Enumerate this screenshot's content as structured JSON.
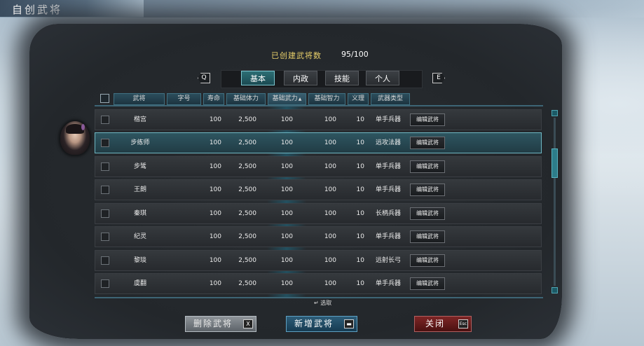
{
  "window": {
    "title": "自创武将"
  },
  "summary": {
    "label": "已创建武将数",
    "value": "95/100"
  },
  "tabs": {
    "prev_key": "Q",
    "next_key": "E",
    "items": [
      {
        "label": "基本",
        "active": true
      },
      {
        "label": "内政",
        "active": false
      },
      {
        "label": "技能",
        "active": false
      },
      {
        "label": "个人",
        "active": false
      }
    ]
  },
  "columns": [
    "武将",
    "字号",
    "寿命",
    "基础体力",
    "基础武力",
    "基础智力",
    "义理",
    "武器类型"
  ],
  "sort_indicator": "▲",
  "rows": [
    {
      "name": "楷宫",
      "life": "100",
      "hp": "2,500",
      "atk": "100",
      "int": "100",
      "loyalty": "10",
      "weapon": "单手兵器",
      "edit": "编辑武将",
      "selected": false
    },
    {
      "name": "步练师",
      "life": "100",
      "hp": "2,500",
      "atk": "100",
      "int": "100",
      "loyalty": "10",
      "weapon": "远攻法器",
      "edit": "编辑武将",
      "selected": true
    },
    {
      "name": "步骘",
      "life": "100",
      "hp": "2,500",
      "atk": "100",
      "int": "100",
      "loyalty": "10",
      "weapon": "单手兵器",
      "edit": "编辑武将",
      "selected": false
    },
    {
      "name": "王朗",
      "life": "100",
      "hp": "2,500",
      "atk": "100",
      "int": "100",
      "loyalty": "10",
      "weapon": "单手兵器",
      "edit": "编辑武将",
      "selected": false
    },
    {
      "name": "秦琪",
      "life": "100",
      "hp": "2,500",
      "atk": "100",
      "int": "100",
      "loyalty": "10",
      "weapon": "长柄兵器",
      "edit": "编辑武将",
      "selected": false
    },
    {
      "name": "纪灵",
      "life": "100",
      "hp": "2,500",
      "atk": "100",
      "int": "100",
      "loyalty": "10",
      "weapon": "单手兵器",
      "edit": "编辑武将",
      "selected": false
    },
    {
      "name": "黎琰",
      "life": "100",
      "hp": "2,500",
      "atk": "100",
      "int": "100",
      "loyalty": "10",
      "weapon": "远射长弓",
      "edit": "编辑武将",
      "selected": false
    },
    {
      "name": "虞翻",
      "life": "100",
      "hp": "2,500",
      "atk": "100",
      "int": "100",
      "loyalty": "10",
      "weapon": "单手兵器",
      "edit": "编辑武将",
      "selected": false
    }
  ],
  "hint": "↵ 选取",
  "buttons": {
    "delete": {
      "label": "删除武将",
      "key": "X"
    },
    "add": {
      "label": "新增武将",
      "key": "▬"
    },
    "close": {
      "label": "关闭",
      "key": "Esc"
    }
  },
  "colors": {
    "accent": "#7cc6cf",
    "count_label": "#e8cf6a",
    "close_button": "#7e2525"
  }
}
